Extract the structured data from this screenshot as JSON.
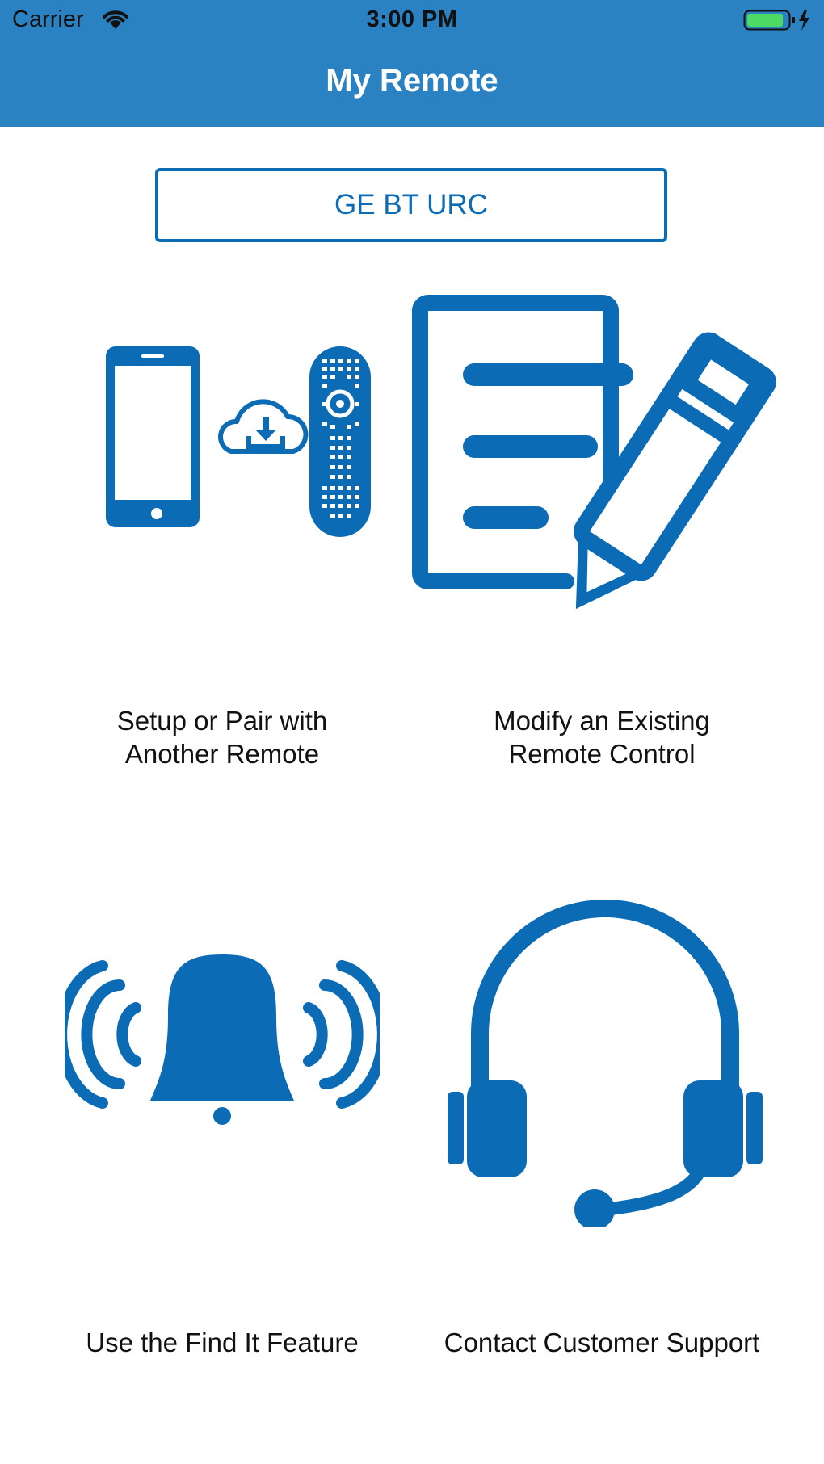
{
  "status_bar": {
    "carrier": "Carrier",
    "time": "3:00 PM"
  },
  "nav": {
    "title": "My Remote"
  },
  "device_button": {
    "label": "GE BT URC"
  },
  "menu": [
    {
      "label_line1": "Setup or Pair with",
      "label_line2": "Another Remote",
      "icon": "phone-cloud-remote-icon"
    },
    {
      "label_line1": "Modify an Existing",
      "label_line2": "Remote Control",
      "icon": "document-pencil-icon"
    },
    {
      "label": "Use the Find It Feature",
      "icon": "ringing-bell-icon"
    },
    {
      "label": "Contact Customer Support",
      "icon": "headset-icon"
    }
  ],
  "colors": {
    "nav_bar": "#2a82c2",
    "accent": "#0b6bb5",
    "battery": "#4cd964"
  }
}
